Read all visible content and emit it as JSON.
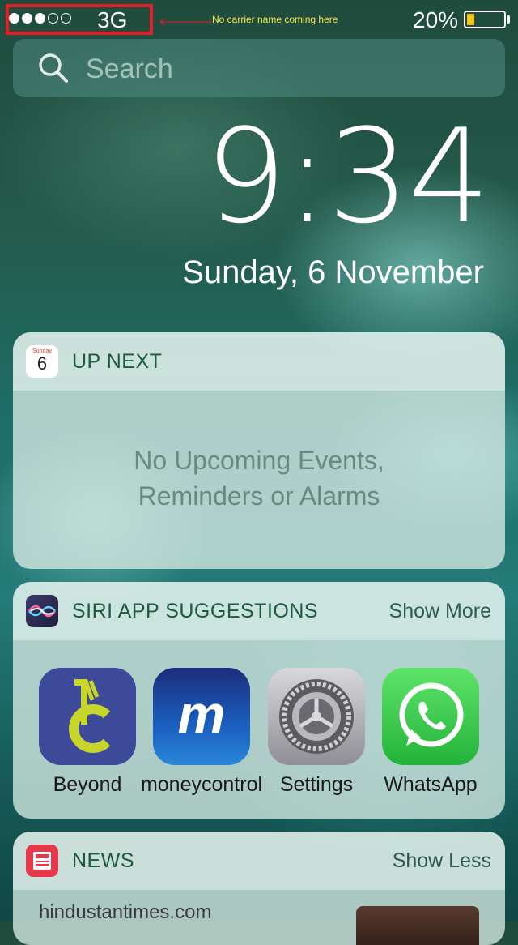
{
  "status_bar": {
    "signal_bars_total": 5,
    "signal_bars_filled": 3,
    "network": "3G",
    "annotation": "No carrier name coming here",
    "battery_percent_label": "20%",
    "battery_level": 0.2,
    "highlight_color": "#e41e26",
    "battery_fill_color": "#f5c518"
  },
  "search": {
    "placeholder": "Search",
    "icon": "search-icon"
  },
  "lockscreen": {
    "time": "9:34",
    "date": "Sunday, 6 November"
  },
  "up_next": {
    "title": "UP NEXT",
    "calendar_icon": {
      "day": "Sunday",
      "date": "6"
    },
    "empty_line1": "No Upcoming Events,",
    "empty_line2": "Reminders or Alarms"
  },
  "siri": {
    "title": "SIRI APP SUGGESTIONS",
    "action": "Show More",
    "apps": [
      {
        "label": "Beyond",
        "icon": "beyond-app-icon"
      },
      {
        "label": "moneycontrol",
        "icon": "moneycontrol-app-icon"
      },
      {
        "label": "Settings",
        "icon": "settings-app-icon"
      },
      {
        "label": "WhatsApp",
        "icon": "whatsapp-app-icon"
      }
    ]
  },
  "news": {
    "title": "NEWS",
    "action": "Show Less",
    "source": "hindustantimes.com"
  }
}
